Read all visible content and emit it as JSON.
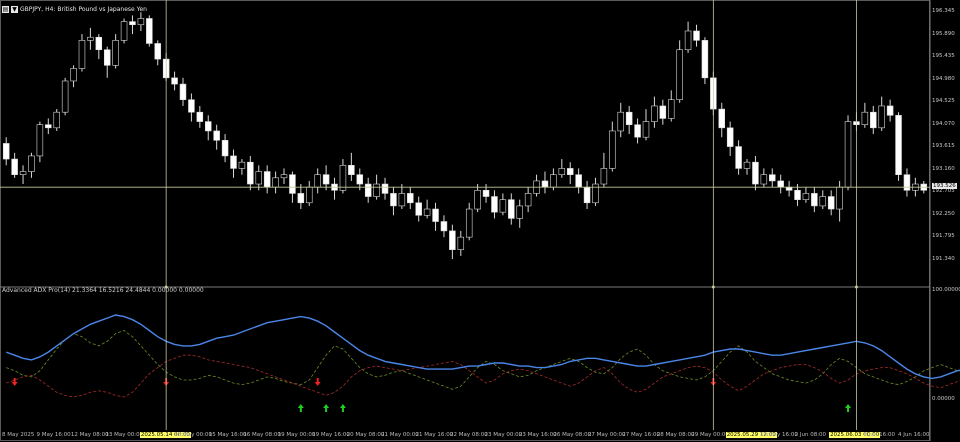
{
  "header": {
    "symbol_icon": "chart-symbol-icon",
    "menu_icon": "dropdown-arrow-icon",
    "title": "GBPJPY, H4: British Pound vs Japanese Yen"
  },
  "indicator": {
    "label": "Advanced ADX Pro(14) 21.3364 16.5216 24.4844 0.00000 0.00000"
  },
  "price_axis": {
    "labels": [
      "196.345",
      "195.890",
      "195.435",
      "194.980",
      "194.525",
      "194.070",
      "193.615",
      "193.160",
      "192.705",
      "192.250",
      "191.795",
      "191.340"
    ],
    "current": "193.526",
    "sub_top": "100.00000",
    "sub_zero": "0.00000"
  },
  "time_axis": {
    "labels": [
      {
        "t": "8 May 2025",
        "hl": false
      },
      {
        "t": "9 May 16:00",
        "hl": false
      },
      {
        "t": "12 May 08:00",
        "hl": false
      },
      {
        "t": "13 May 00:00",
        "hl": false
      },
      {
        "t": "2025.05.14 08:00",
        "hl": true
      },
      {
        "t": "15 May 00:00",
        "hl": false
      },
      {
        "t": "15 May 16:00",
        "hl": false
      },
      {
        "t": "16 May 08:00",
        "hl": false
      },
      {
        "t": "19 May 00:00",
        "hl": false
      },
      {
        "t": "19 May 16:00",
        "hl": false
      },
      {
        "t": "20 May 08:00",
        "hl": false
      },
      {
        "t": "21 May 00:00",
        "hl": false
      },
      {
        "t": "21 May 16:00",
        "hl": false
      },
      {
        "t": "22 May 08:00",
        "hl": false
      },
      {
        "t": "23 May 00:00",
        "hl": false
      },
      {
        "t": "23 May 16:00",
        "hl": false
      },
      {
        "t": "26 May 08:00",
        "hl": false
      },
      {
        "t": "27 May 00:00",
        "hl": false
      },
      {
        "t": "27 May 16:00",
        "hl": false
      },
      {
        "t": "28 May 08:00",
        "hl": false
      },
      {
        "t": "29 May 00:00",
        "hl": false
      },
      {
        "t": "2025.05.29 12:00",
        "hl": true
      },
      {
        "t": "30 May 16:00",
        "hl": false
      },
      {
        "t": "2 Jun 08:00",
        "hl": false
      },
      {
        "t": "2025.06.03 00:00",
        "hl": true
      },
      {
        "t": "3 Jun 16:00",
        "hl": false
      },
      {
        "t": "4 Jun 16:00",
        "hl": false
      }
    ]
  },
  "colors": {
    "background": "#000000",
    "bull_candle": "#000000",
    "bear_candle": "#ffffff",
    "wick": "#d8d8d8",
    "crosshair": "#c8c8a0",
    "adx_line": "#4a86e8",
    "di_plus": "#6b8e23",
    "di_minus": "#a52a2a",
    "signal_up": "#22cc22",
    "signal_down": "#ee2222",
    "highlight": "#ffff66"
  },
  "candles": [
    [
      194.25,
      194.0,
      194.35,
      193.9
    ],
    [
      194.0,
      193.75,
      194.1,
      193.7
    ],
    [
      193.75,
      193.8,
      193.9,
      193.6
    ],
    [
      193.8,
      194.05,
      194.1,
      193.7
    ],
    [
      194.05,
      194.55,
      194.6,
      193.95
    ],
    [
      194.55,
      194.5,
      194.65,
      194.4
    ],
    [
      194.5,
      194.75,
      194.8,
      194.45
    ],
    [
      194.75,
      195.25,
      195.3,
      194.7
    ],
    [
      195.25,
      195.45,
      195.5,
      195.15
    ],
    [
      195.45,
      195.9,
      196.0,
      195.4
    ],
    [
      195.9,
      195.95,
      196.1,
      195.75
    ],
    [
      195.95,
      195.75,
      196.0,
      195.6
    ],
    [
      195.75,
      195.5,
      195.8,
      195.3
    ],
    [
      195.5,
      195.9,
      196.0,
      195.45
    ],
    [
      195.9,
      196.2,
      196.25,
      195.85
    ],
    [
      196.2,
      196.15,
      196.3,
      196.0
    ],
    [
      196.15,
      196.25,
      196.35,
      196.05
    ],
    [
      196.25,
      195.85,
      196.3,
      195.8
    ],
    [
      195.85,
      195.6,
      195.9,
      195.5
    ],
    [
      195.6,
      195.3,
      195.7,
      195.25
    ],
    [
      195.3,
      195.2,
      195.4,
      195.1
    ],
    [
      195.2,
      194.95,
      195.3,
      194.85
    ],
    [
      194.95,
      194.75,
      195.05,
      194.6
    ],
    [
      194.75,
      194.6,
      194.85,
      194.5
    ],
    [
      194.6,
      194.45,
      194.7,
      194.3
    ],
    [
      194.45,
      194.3,
      194.55,
      194.15
    ],
    [
      194.3,
      194.05,
      194.4,
      193.95
    ],
    [
      194.05,
      193.85,
      194.15,
      193.7
    ],
    [
      193.85,
      193.95,
      194.0,
      193.75
    ],
    [
      193.95,
      193.6,
      194.05,
      193.5
    ],
    [
      193.6,
      193.8,
      193.9,
      193.5
    ],
    [
      193.8,
      193.55,
      193.9,
      193.45
    ],
    [
      193.55,
      193.7,
      193.8,
      193.45
    ],
    [
      193.7,
      193.75,
      193.85,
      193.6
    ],
    [
      193.75,
      193.45,
      193.8,
      193.3
    ],
    [
      193.45,
      193.3,
      193.6,
      193.2
    ],
    [
      193.3,
      193.55,
      193.65,
      193.25
    ],
    [
      193.55,
      193.75,
      193.85,
      193.45
    ],
    [
      193.75,
      193.6,
      193.9,
      193.5
    ],
    [
      193.6,
      193.5,
      193.7,
      193.35
    ],
    [
      193.5,
      193.9,
      194.0,
      193.45
    ],
    [
      193.9,
      193.75,
      194.1,
      193.65
    ],
    [
      193.75,
      193.6,
      193.85,
      193.5
    ],
    [
      193.6,
      193.4,
      193.7,
      193.3
    ],
    [
      193.4,
      193.6,
      193.75,
      193.35
    ],
    [
      193.6,
      193.45,
      193.7,
      193.35
    ],
    [
      193.45,
      193.25,
      193.55,
      193.1
    ],
    [
      193.25,
      193.45,
      193.6,
      193.2
    ],
    [
      193.45,
      193.3,
      193.55,
      193.2
    ],
    [
      193.3,
      193.1,
      193.4,
      193.0
    ],
    [
      193.1,
      193.2,
      193.35,
      193.05
    ],
    [
      193.2,
      193.0,
      193.3,
      192.85
    ],
    [
      193.0,
      192.85,
      193.1,
      192.75
    ],
    [
      192.85,
      192.55,
      192.95,
      192.4
    ],
    [
      192.55,
      192.75,
      192.85,
      192.45
    ],
    [
      192.75,
      193.2,
      193.3,
      192.7
    ],
    [
      193.2,
      193.5,
      193.6,
      193.15
    ],
    [
      193.5,
      193.4,
      193.6,
      193.3
    ],
    [
      193.4,
      193.15,
      193.5,
      193.05
    ],
    [
      193.15,
      193.35,
      193.45,
      193.1
    ],
    [
      193.35,
      193.05,
      193.45,
      192.95
    ],
    [
      193.05,
      193.25,
      193.35,
      192.9
    ],
    [
      193.25,
      193.45,
      193.55,
      193.15
    ],
    [
      193.45,
      193.65,
      193.75,
      193.4
    ],
    [
      193.65,
      193.55,
      193.8,
      193.45
    ],
    [
      193.55,
      193.75,
      193.85,
      193.5
    ],
    [
      193.75,
      193.85,
      194.0,
      193.7
    ],
    [
      193.85,
      193.75,
      193.95,
      193.6
    ],
    [
      193.75,
      193.55,
      193.85,
      193.45
    ],
    [
      193.55,
      193.3,
      193.65,
      193.2
    ],
    [
      193.3,
      193.6,
      193.7,
      193.25
    ],
    [
      193.6,
      193.85,
      194.1,
      193.55
    ],
    [
      193.85,
      194.45,
      194.6,
      193.8
    ],
    [
      194.45,
      194.75,
      194.9,
      194.35
    ],
    [
      194.75,
      194.55,
      194.85,
      194.4
    ],
    [
      194.55,
      194.35,
      194.65,
      194.25
    ],
    [
      194.35,
      194.6,
      194.8,
      194.3
    ],
    [
      194.6,
      194.85,
      195.0,
      194.5
    ],
    [
      194.85,
      194.65,
      194.95,
      194.55
    ],
    [
      194.65,
      194.95,
      195.1,
      194.6
    ],
    [
      194.95,
      195.75,
      195.9,
      194.9
    ],
    [
      195.75,
      196.05,
      196.2,
      195.7
    ],
    [
      196.05,
      195.9,
      196.15,
      195.8
    ],
    [
      195.9,
      195.3,
      195.95,
      195.2
    ],
    [
      195.3,
      194.8,
      195.4,
      194.7
    ],
    [
      194.8,
      194.5,
      194.9,
      194.35
    ],
    [
      194.5,
      194.2,
      194.6,
      194.05
    ],
    [
      194.2,
      193.85,
      194.3,
      193.75
    ],
    [
      193.85,
      193.95,
      194.0,
      193.75
    ],
    [
      193.95,
      193.6,
      194.05,
      193.5
    ],
    [
      193.6,
      193.75,
      193.85,
      193.55
    ],
    [
      193.75,
      193.65,
      193.85,
      193.55
    ],
    [
      193.65,
      193.55,
      193.75,
      193.45
    ],
    [
      193.55,
      193.5,
      193.65,
      193.4
    ],
    [
      193.5,
      193.35,
      193.6,
      193.25
    ],
    [
      193.35,
      193.45,
      193.55,
      193.3
    ],
    [
      193.45,
      193.25,
      193.55,
      193.15
    ],
    [
      193.25,
      193.4,
      193.5,
      193.2
    ],
    [
      193.4,
      193.2,
      193.5,
      193.1
    ],
    [
      193.2,
      193.55,
      193.65,
      193.0
    ],
    [
      193.55,
      194.6,
      194.7,
      193.5
    ],
    [
      194.6,
      194.55,
      194.75,
      194.45
    ],
    [
      194.55,
      194.75,
      194.9,
      194.5
    ],
    [
      194.75,
      194.5,
      194.85,
      194.4
    ],
    [
      194.5,
      194.85,
      195.0,
      194.45
    ],
    [
      194.85,
      194.7,
      194.95,
      194.6
    ],
    [
      194.7,
      193.75,
      194.75,
      193.65
    ],
    [
      193.75,
      193.5,
      193.85,
      193.4
    ],
    [
      193.5,
      193.6,
      193.7,
      193.4
    ],
    [
      193.6,
      193.5,
      193.65,
      193.45
    ]
  ],
  "adx": [
    40,
    38,
    36,
    35,
    37,
    40,
    44,
    48,
    52,
    55,
    58,
    60,
    62,
    64,
    63,
    61,
    58,
    54,
    50,
    47,
    45,
    44,
    44,
    45,
    47,
    49,
    50,
    51,
    53,
    55,
    57,
    59,
    60,
    61,
    62,
    63,
    62,
    60,
    57,
    53,
    49,
    45,
    41,
    38,
    36,
    34,
    33,
    32,
    31,
    30,
    29,
    29,
    29,
    29,
    30,
    31,
    31,
    32,
    33,
    33,
    32,
    31,
    31,
    30,
    30,
    31,
    32,
    34,
    35,
    36,
    36,
    35,
    34,
    33,
    32,
    31,
    31,
    32,
    33,
    34,
    35,
    36,
    37,
    38,
    40,
    41,
    42,
    42,
    41,
    40,
    39,
    38,
    38,
    39,
    40,
    41,
    42,
    43,
    44,
    45,
    46,
    47,
    46,
    44,
    41,
    37,
    33,
    29,
    26,
    24,
    23,
    24,
    26,
    28,
    29
  ],
  "di_plus": [
    30,
    28,
    25,
    24,
    28,
    35,
    42,
    48,
    52,
    50,
    46,
    44,
    47,
    52,
    54,
    50,
    44,
    38,
    32,
    27,
    24,
    22,
    22,
    23,
    25,
    24,
    22,
    20,
    19,
    20,
    22,
    24,
    23,
    21,
    20,
    19,
    22,
    30,
    38,
    44,
    42,
    36,
    30,
    26,
    24,
    25,
    27,
    28,
    26,
    24,
    22,
    20,
    18,
    16,
    18,
    24,
    30,
    34,
    32,
    28,
    26,
    24,
    25,
    28,
    30,
    32,
    34,
    36,
    34,
    30,
    27,
    26,
    30,
    36,
    40,
    42,
    38,
    32,
    28,
    26,
    24,
    23,
    22,
    24,
    28,
    34,
    40,
    44,
    40,
    34,
    30,
    26,
    24,
    22,
    21,
    20,
    22,
    26,
    32,
    36,
    34,
    30,
    26,
    24,
    22,
    20,
    19,
    21,
    24,
    28,
    30,
    32,
    30,
    28,
    27
  ],
  "di_minus": [
    20,
    22,
    24,
    25,
    22,
    18,
    14,
    12,
    11,
    12,
    14,
    15,
    14,
    12,
    11,
    14,
    20,
    26,
    30,
    34,
    36,
    38,
    38,
    37,
    35,
    34,
    33,
    32,
    31,
    30,
    28,
    26,
    24,
    22,
    20,
    18,
    16,
    14,
    12,
    14,
    18,
    24,
    28,
    30,
    31,
    30,
    29,
    28,
    29,
    30,
    31,
    32,
    33,
    34,
    32,
    28,
    24,
    20,
    22,
    26,
    28,
    29,
    28,
    26,
    24,
    22,
    20,
    18,
    20,
    24,
    28,
    30,
    26,
    20,
    16,
    14,
    16,
    20,
    24,
    26,
    28,
    30,
    31,
    30,
    27,
    22,
    18,
    15,
    18,
    22,
    26,
    28,
    30,
    31,
    32,
    32,
    30,
    27,
    23,
    20,
    22,
    26,
    28,
    29,
    30,
    30,
    28,
    26,
    23,
    20,
    18,
    17,
    19,
    21,
    22
  ],
  "signals": [
    {
      "i": 1,
      "dir": "down"
    },
    {
      "i": 19,
      "dir": "down"
    },
    {
      "i": 35,
      "dir": "up"
    },
    {
      "i": 37,
      "dir": "down"
    },
    {
      "i": 38,
      "dir": "up"
    },
    {
      "i": 40,
      "dir": "up"
    },
    {
      "i": 84,
      "dir": "down"
    },
    {
      "i": 100,
      "dir": "up"
    }
  ],
  "crosshair": {
    "price": 193.55
  },
  "vlines": [
    19,
    84,
    101
  ]
}
